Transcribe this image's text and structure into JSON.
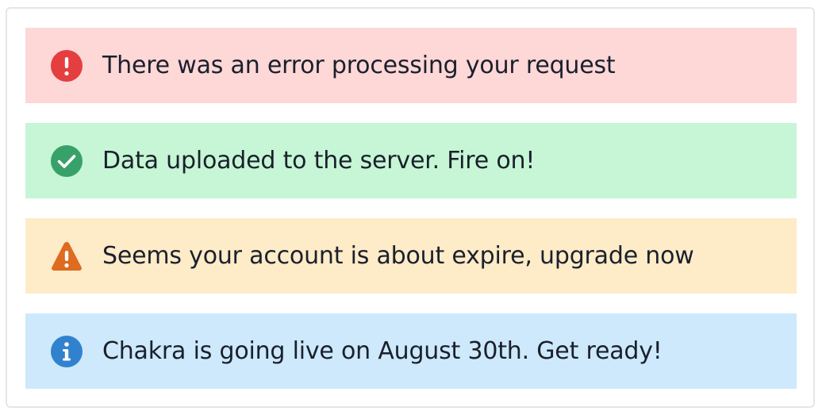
{
  "alerts": [
    {
      "status": "error",
      "icon": "error-exclamation-icon",
      "message": "There was an error processing your request",
      "background": "#fed7d7",
      "icon_color": "#e53e3e"
    },
    {
      "status": "success",
      "icon": "check-circle-icon",
      "message": "Data uploaded to the server. Fire on!",
      "background": "#c6f6d5",
      "icon_color": "#38a169"
    },
    {
      "status": "warning",
      "icon": "warning-triangle-icon",
      "message": "Seems your account is about expire, upgrade now",
      "background": "#feebc8",
      "icon_color": "#dd6b20"
    },
    {
      "status": "info",
      "icon": "info-circle-icon",
      "message": "Chakra is going live on August 30th. Get ready!",
      "background": "#cde9fb",
      "icon_color": "#3182ce"
    }
  ]
}
